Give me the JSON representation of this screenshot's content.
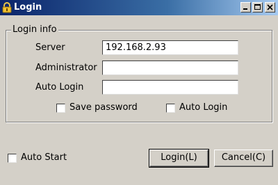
{
  "window": {
    "title": "Login",
    "icon": "lock-icon",
    "controls": [
      "minimize-icon",
      "maximize-icon",
      "close-icon"
    ]
  },
  "login_info": {
    "legend": "Login info",
    "server": {
      "label": "Server",
      "value": "192.168.2.93"
    },
    "administrator": {
      "label": "Administrator",
      "value": ""
    },
    "auto_login_field": {
      "label": "Auto Login",
      "value": ""
    },
    "save_password": {
      "label": "Save password",
      "checked": false
    },
    "auto_login_check": {
      "label": "Auto Login",
      "checked": false
    }
  },
  "footer": {
    "auto_start": {
      "label": "Auto Start",
      "checked": false
    },
    "login_button": "Login(L)",
    "cancel_button": "Cancel(C)"
  }
}
